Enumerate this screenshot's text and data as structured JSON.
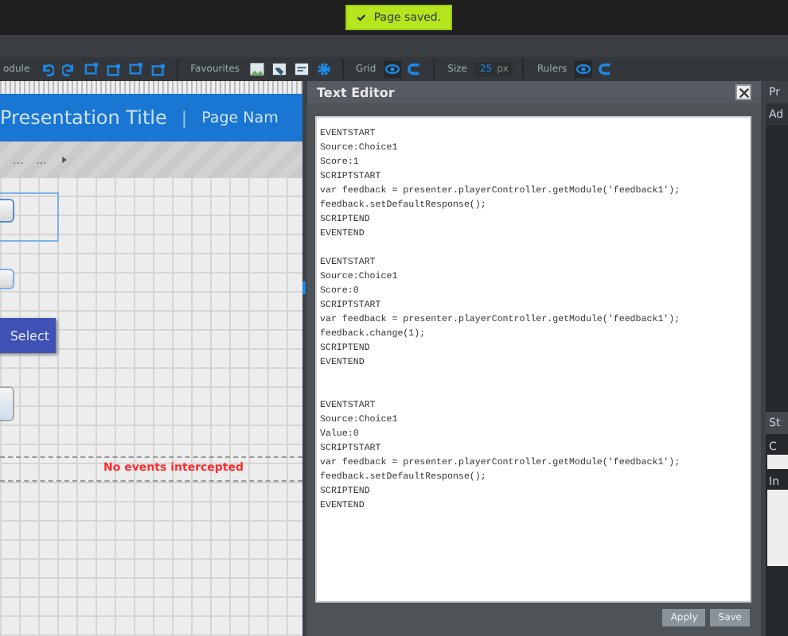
{
  "toast": {
    "text": "Page saved."
  },
  "toolbar": {
    "module_label": "odule",
    "favourites_label": "Favourites",
    "grid_label": "Grid",
    "grid_visible": true,
    "size_label": "Size",
    "size_value": "25",
    "size_unit": "px",
    "rulers_label": "Rulers",
    "rulers_visible": true
  },
  "canvas": {
    "header_title": "Presentation Title",
    "header_separator": "|",
    "page_name": "Page Nam",
    "breadcrumbs": [
      "...",
      "..."
    ],
    "select_button": "Select",
    "status_text": "No events intercepted"
  },
  "text_editor": {
    "title": "Text Editor",
    "text": "EVENTSTART\nSource:Choice1\nScore:1\nSCRIPTSTART\nvar feedback = presenter.playerController.getModule('feedback1');\nfeedback.setDefaultResponse();\nSCRIPTEND\nEVENTEND\n\nEVENTSTART\nSource:Choice1\nScore:0\nSCRIPTSTART\nvar feedback = presenter.playerController.getModule('feedback1');\nfeedback.change(1);\nSCRIPTEND\nEVENTEND\n\n\nEVENTSTART\nSource:Choice1\nValue:0\nSCRIPTSTART\nvar feedback = presenter.playerController.getModule('feedback1');\nfeedback.setDefaultResponse();\nSCRIPTEND\nEVENTEND",
    "buttons": [
      "Apply",
      "Save"
    ]
  },
  "right_panel": {
    "header": "Pr",
    "tab": "Ad",
    "section": "St",
    "field_label": "C",
    "textarea_label": "In"
  }
}
